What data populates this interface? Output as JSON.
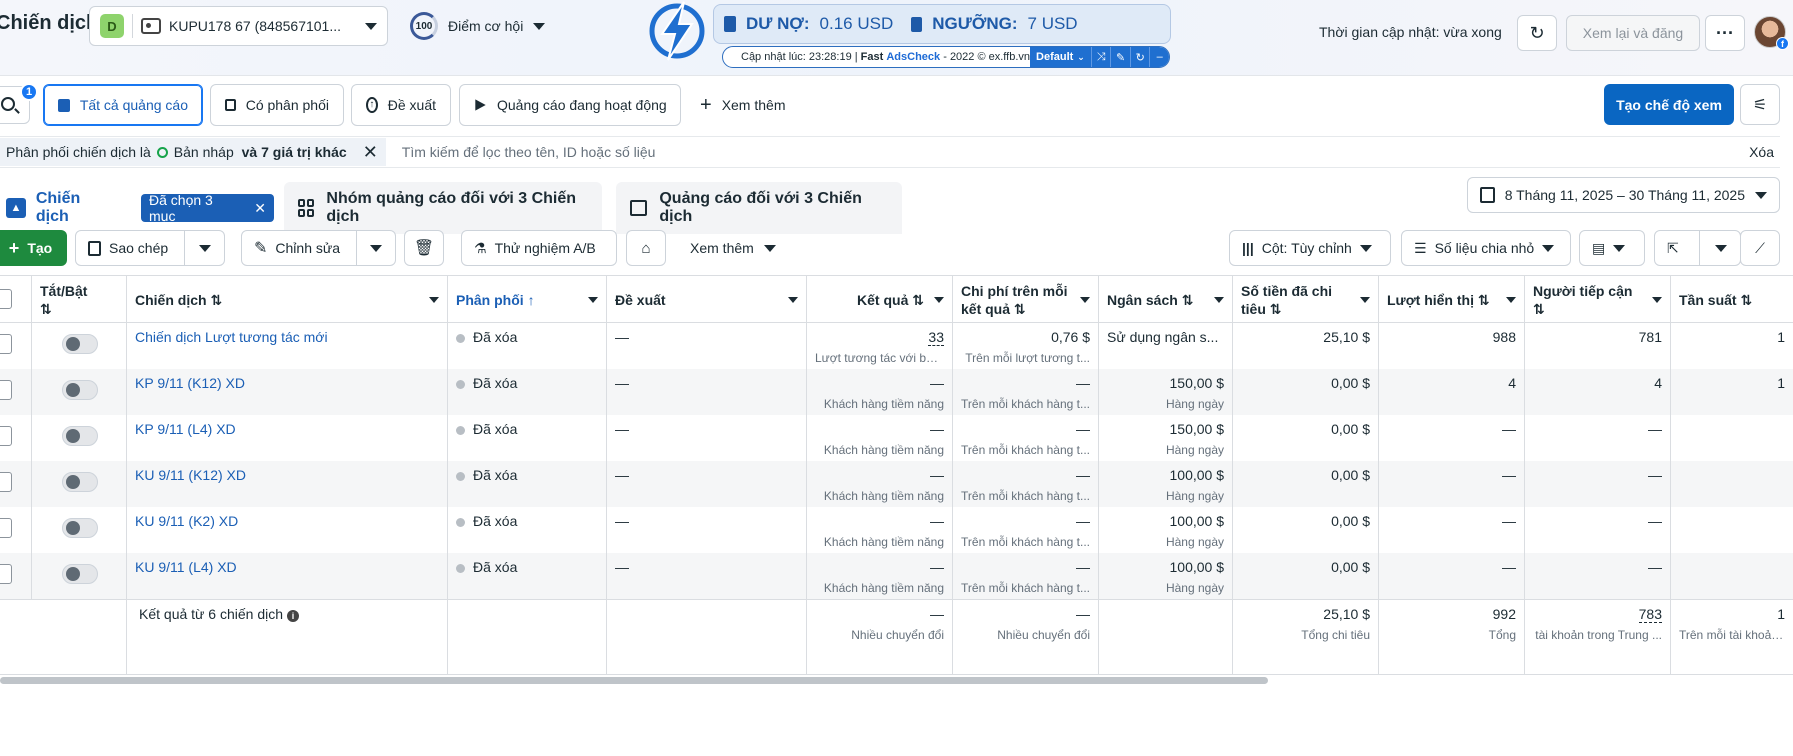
{
  "header": {
    "page_title": "Chiến dịch",
    "account_badge": "D",
    "account_name": "KUPU178 67 (848567101...",
    "opp_score": "100",
    "opp_label": "Điểm cơ hội",
    "updated_text": "Thời gian cập nhật: vừa xong",
    "review_label": "Xem lại và đăng",
    "more_label": "···"
  },
  "adscheck": {
    "debt_label": "DƯ NỢ:",
    "debt_value": "0.16 USD",
    "threshold_label": "NGƯỠNG:",
    "threshold_value": "7 USD",
    "updated_prefix": "Cập nhật lúc: 23:28:19 |",
    "brand_fast": "Fast",
    "brand_name": "AdsCheck",
    "brand_suffix": "- 2022 © ex.ffb.vn",
    "profile": "Default"
  },
  "filter_tabs": {
    "notif_count": "1",
    "all_ads": "Tất cả quảng cáo",
    "delivering": "Có phân phối",
    "recommendations": "Đề xuất",
    "active_ads": "Quảng cáo đang hoạt động",
    "see_more": "Xem thêm",
    "create_view": "Tạo chế độ xem"
  },
  "filter_bar": {
    "chip_prefix": "Phân phối chiến dịch là",
    "chip_value": "Bản nháp",
    "chip_suffix": "và 7 giá trị khác",
    "search_placeholder": "Tìm kiếm để lọc theo tên, ID hoặc số liệu",
    "clear": "Xóa"
  },
  "level_tabs": {
    "campaign": "Chiến dịch",
    "selected": "Đã chọn 3 mục",
    "adsets": "Nhóm quảng cáo đối với 3 Chiến dịch",
    "ads": "Quảng cáo đối với 3 Chiến dịch",
    "date_range": "8 Tháng 11, 2025 – 30 Tháng 11, 2025"
  },
  "toolbar": {
    "create": "Tạo",
    "duplicate": "Sao chép",
    "edit": "Chỉnh sửa",
    "ab_test": "Thử nghiệm A/B",
    "see_more": "Xem thêm",
    "columns": "Cột: Tùy chỉnh",
    "breakdown": "Số liệu chia nhỏ"
  },
  "table": {
    "columns": {
      "toggle": "Tắt/Bật",
      "campaign": "Chiến dịch",
      "delivery": "Phân phối",
      "recommendations": "Đề xuất",
      "results": "Kết quả",
      "cost_per_result": "Chi phí trên mỗi kết quả",
      "budget": "Ngân sách",
      "amount_spent": "Số tiền đã chi tiêu",
      "impressions": "Lượt hiển thị",
      "reach": "Người tiếp cận",
      "frequency": "Tần suất"
    },
    "rows": [
      {
        "name": "Chiến dịch Lượt tương tác mới",
        "delivery": "Đã xóa",
        "rec": "—",
        "results": "33",
        "results_sub": "Lượt tương tác với bài...",
        "cpr": "0,76 $",
        "cpr_sub": "Trên mỗi lượt tương t...",
        "budget": "Sử dụng ngân s...",
        "budget_sub": "",
        "spent": "25,10 $",
        "impressions": "988",
        "reach": "781",
        "freq": "1"
      },
      {
        "name": "KP 9/11 (K12) XD",
        "delivery": "Đã xóa",
        "rec": "—",
        "results": "—",
        "results_sub": "Khách hàng tiềm năng",
        "cpr": "—",
        "cpr_sub": "Trên mỗi khách hàng t...",
        "budget": "150,00 $",
        "budget_sub": "Hàng ngày",
        "spent": "0,00 $",
        "impressions": "4",
        "reach": "4",
        "freq": "1"
      },
      {
        "name": "KP 9/11 (L4) XD",
        "delivery": "Đã xóa",
        "rec": "—",
        "results": "—",
        "results_sub": "Khách hàng tiềm năng",
        "cpr": "—",
        "cpr_sub": "Trên mỗi khách hàng t...",
        "budget": "150,00 $",
        "budget_sub": "Hàng ngày",
        "spent": "0,00 $",
        "impressions": "—",
        "reach": "—",
        "freq": ""
      },
      {
        "name": "KU 9/11 (K12) XD",
        "delivery": "Đã xóa",
        "rec": "—",
        "results": "—",
        "results_sub": "Khách hàng tiềm năng",
        "cpr": "—",
        "cpr_sub": "Trên mỗi khách hàng t...",
        "budget": "100,00 $",
        "budget_sub": "Hàng ngày",
        "spent": "0,00 $",
        "impressions": "—",
        "reach": "—",
        "freq": ""
      },
      {
        "name": "KU 9/11 (K2) XD",
        "delivery": "Đã xóa",
        "rec": "—",
        "results": "—",
        "results_sub": "Khách hàng tiềm năng",
        "cpr": "—",
        "cpr_sub": "Trên mỗi khách hàng t...",
        "budget": "100,00 $",
        "budget_sub": "Hàng ngày",
        "spent": "0,00 $",
        "impressions": "—",
        "reach": "—",
        "freq": ""
      },
      {
        "name": "KU 9/11 (L4) XD",
        "delivery": "Đã xóa",
        "rec": "—",
        "results": "—",
        "results_sub": "Khách hàng tiềm năng",
        "cpr": "—",
        "cpr_sub": "Trên mỗi khách hàng t...",
        "budget": "100,00 $",
        "budget_sub": "Hàng ngày",
        "spent": "0,00 $",
        "impressions": "—",
        "reach": "—",
        "freq": ""
      }
    ],
    "footer": {
      "label": "Kết quả từ 6 chiến dịch",
      "results": "—",
      "results_sub": "Nhiều chuyển đổi",
      "cpr": "—",
      "cpr_sub": "Nhiều chuyển đổi",
      "spent": "25,10 $",
      "spent_sub": "Tổng chi tiêu",
      "impressions": "992",
      "impressions_sub": "Tổng",
      "reach": "783",
      "reach_sub": "tài khoản trong Trung ...",
      "freq": "1",
      "freq_sub": "Trên mỗi tài khoản t..."
    }
  },
  "colors": {
    "primary": "#0a66c2",
    "link": "#1b5fb5",
    "create_green": "#1e8a3e"
  }
}
